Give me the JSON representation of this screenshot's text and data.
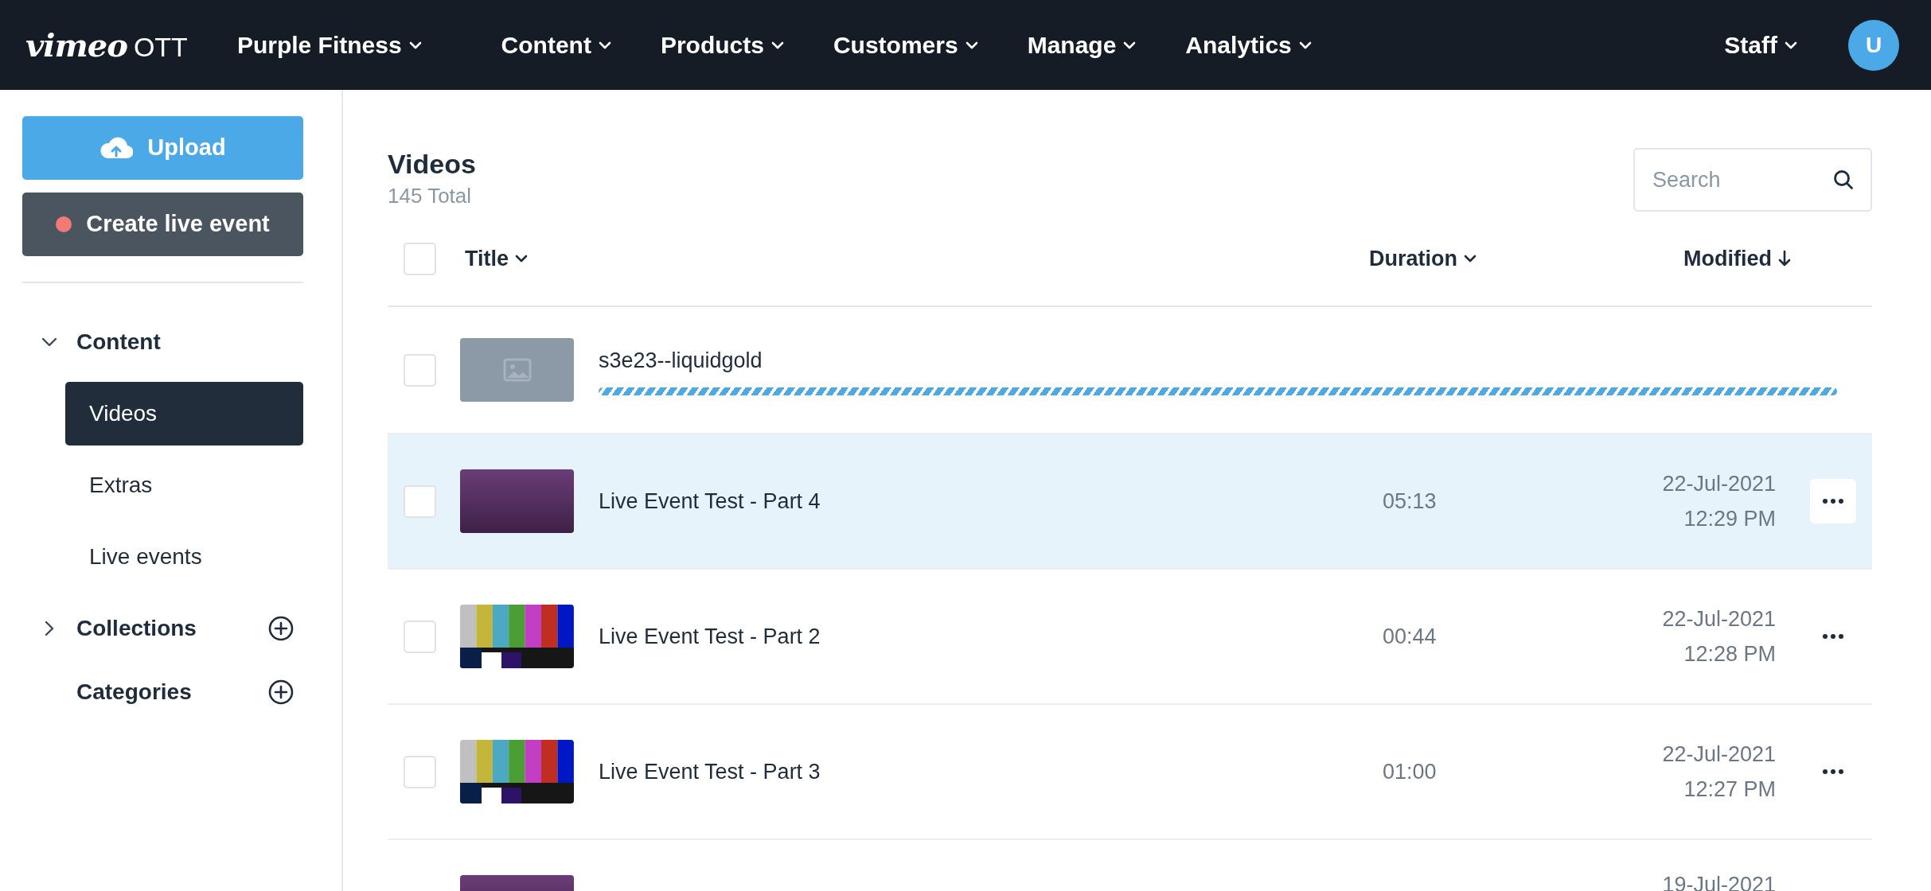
{
  "navbar": {
    "logo": {
      "wordmark": "vimeo",
      "suffix": "OTT"
    },
    "site": "Purple Fitness",
    "menu": [
      "Content",
      "Products",
      "Customers",
      "Manage",
      "Analytics"
    ],
    "account": "Staff",
    "avatar": "U"
  },
  "sidebar": {
    "buttons": [
      {
        "kind": "upload",
        "label": "Upload"
      },
      {
        "kind": "live",
        "label": "Create live event"
      }
    ],
    "items": [
      {
        "label": "Content",
        "kind": "group",
        "expanded": true,
        "add": false,
        "children": [
          {
            "label": "Videos",
            "selected": true
          },
          {
            "label": "Extras",
            "selected": false
          },
          {
            "label": "Live events",
            "selected": false
          }
        ]
      },
      {
        "label": "Collections",
        "kind": "group",
        "expanded": false,
        "add": true
      },
      {
        "label": "Categories",
        "kind": "leaf",
        "add": true
      }
    ]
  },
  "page": {
    "title": "Videos",
    "count": "145 Total",
    "search": {
      "placeholder": "Search"
    }
  },
  "table": {
    "select_all": {
      "checked": false
    },
    "columns": [
      {
        "label": "Title",
        "sorted": false
      },
      {
        "label": "Duration",
        "sorted": false
      },
      {
        "label": "Modified",
        "sorted": true
      }
    ],
    "rows": [
      {
        "title": "s3e23--liquidgold",
        "thumbnail": {
          "kind": "blank"
        },
        "checked": false,
        "highlighted": false,
        "uploading": true,
        "menu": false
      },
      {
        "title": "Live Event Test - Part 4",
        "thumbnail": {
          "kind": "photo"
        },
        "checked": false,
        "highlighted": true,
        "uploading": false,
        "duration": "05:13",
        "date": "22-Jul-2021",
        "time": "12:29 PM",
        "menu": true
      },
      {
        "title": "Live Event Test - Part 2",
        "thumbnail": {
          "kind": "bars"
        },
        "checked": false,
        "highlighted": false,
        "uploading": false,
        "duration": "00:44",
        "date": "22-Jul-2021",
        "time": "12:28 PM",
        "menu": true
      },
      {
        "title": "Live Event Test - Part 3",
        "thumbnail": {
          "kind": "bars"
        },
        "checked": false,
        "highlighted": false,
        "uploading": false,
        "duration": "01:00",
        "date": "22-Jul-2021",
        "time": "12:27 PM",
        "menu": true
      },
      {
        "thumbnail": {
          "kind": "photo"
        },
        "highlighted": false,
        "uploading": false,
        "date": "19-Jul-2021",
        "menu": false
      }
    ]
  }
}
